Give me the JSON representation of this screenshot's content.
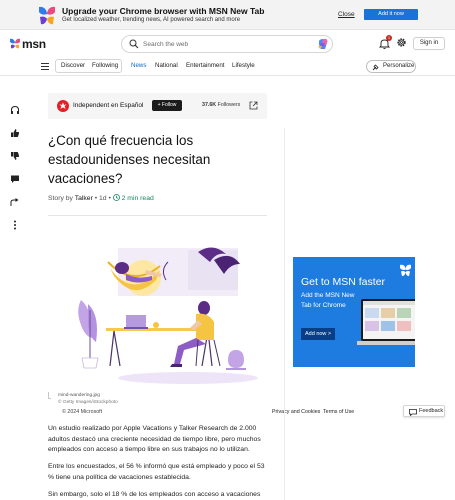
{
  "banner": {
    "title": "Upgrade your Chrome browser with MSN New Tab",
    "subtitle": "Get localized weather, trending news, AI powered search and more",
    "close_label": "Close",
    "add_label": "Add it now"
  },
  "header": {
    "logo_text": "msn",
    "search_placeholder": "Search the web",
    "notification_count": "1",
    "signin_label": "Sign in"
  },
  "nav": {
    "items": [
      {
        "label": "Discover"
      },
      {
        "label": "Following"
      },
      {
        "label": "News"
      },
      {
        "label": "National"
      },
      {
        "label": "Entertainment"
      },
      {
        "label": "Lifestyle"
      }
    ],
    "personalize_label": "Personalize",
    "active_color": "#0f6cbd"
  },
  "publisher": {
    "name": "Independent en Español",
    "follow_label": "+ Follow",
    "followers_count": "37.6K",
    "followers_label": "Followers"
  },
  "article": {
    "headline": "¿Con qué frecuencia los estadounidenses necesitan vacaciones?",
    "story_by": "Story by",
    "author": "Talker",
    "age": "1d",
    "read_time": "2 min read",
    "image_filename": "mind-wandering.jpg",
    "image_credit": "© Getty Images/iStockphoto",
    "paragraphs": [
      "Un estudio realizado por Apple Vacations y Talker Research de 2.000 adultos destacó una creciente necesidad de tiempo libre, pero muchos empleados con acceso a tiempo libre en sus trabajos no lo utilizan.",
      "Entre los encuestados, el 56 % informó que está empleado y poco el 53 % tiene una política de vacaciones establecida.",
      "Sin embargo, solo el 18 % de los empleados con acceso a vacaciones"
    ]
  },
  "ad": {
    "title": "Get to MSN faster",
    "body": "Add the MSN New Tab for Chrome",
    "button_label": "Add now >",
    "bg_color": "#1e7be0"
  },
  "footer": {
    "copyright": "© 2024 Microsoft",
    "privacy_label": "Privacy and Cookies",
    "terms_label": "Terms of Use",
    "feedback_label": "Feedback"
  }
}
